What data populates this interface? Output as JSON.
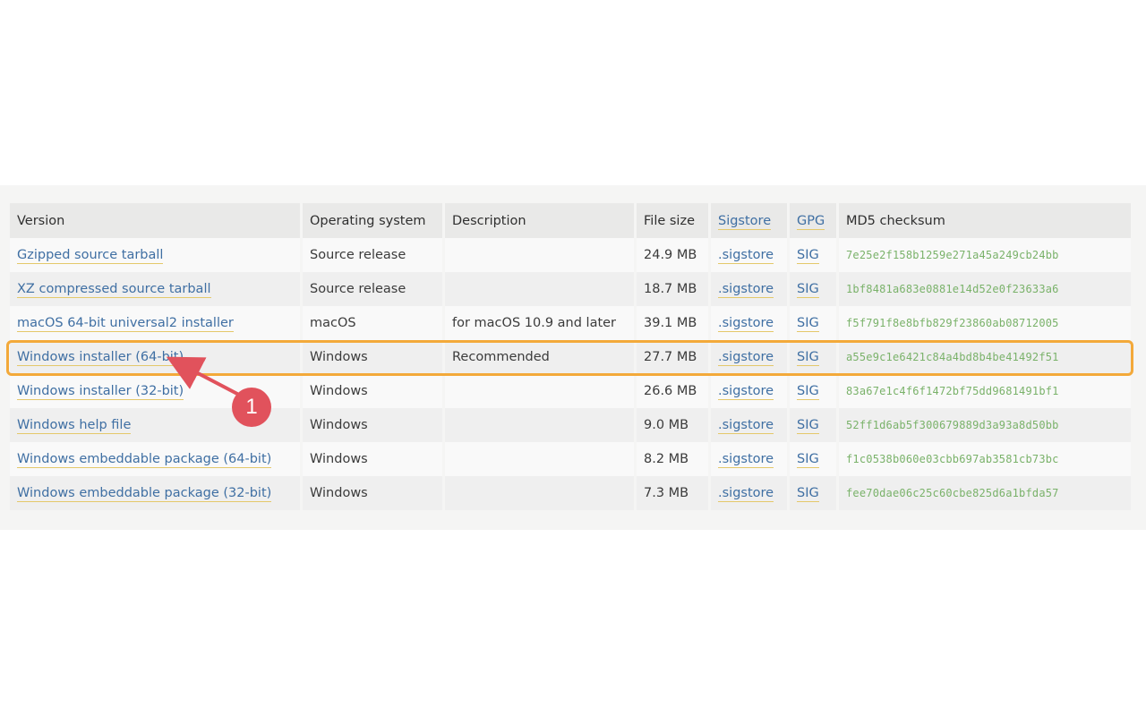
{
  "table": {
    "headers": {
      "version": "Version",
      "os": "Operating system",
      "description": "Description",
      "filesize": "File size",
      "sigstore": "Sigstore",
      "gpg": "GPG",
      "md5": "MD5 checksum"
    },
    "rows": [
      {
        "version": "Gzipped source tarball",
        "os": "Source release",
        "description": "",
        "filesize": "24.9 MB",
        "sigstore": ".sigstore",
        "gpg": "SIG",
        "md5": "7e25e2f158b1259e271a45a249cb24bb"
      },
      {
        "version": "XZ compressed source tarball",
        "os": "Source release",
        "description": "",
        "filesize": "18.7 MB",
        "sigstore": ".sigstore",
        "gpg": "SIG",
        "md5": "1bf8481a683e0881e14d52e0f23633a6"
      },
      {
        "version": "macOS 64-bit universal2 installer",
        "os": "macOS",
        "description": "for macOS 10.9 and later",
        "filesize": "39.1 MB",
        "sigstore": ".sigstore",
        "gpg": "SIG",
        "md5": "f5f791f8e8bfb829f23860ab08712005"
      },
      {
        "version": "Windows installer (64-bit)",
        "os": "Windows",
        "description": "Recommended",
        "filesize": "27.7 MB",
        "sigstore": ".sigstore",
        "gpg": "SIG",
        "md5": "a55e9c1e6421c84a4bd8b4be41492f51"
      },
      {
        "version": "Windows installer (32-bit)",
        "os": "Windows",
        "description": "",
        "filesize": "26.6 MB",
        "sigstore": ".sigstore",
        "gpg": "SIG",
        "md5": "83a67e1c4f6f1472bf75dd9681491bf1"
      },
      {
        "version": "Windows help file",
        "os": "Windows",
        "description": "",
        "filesize": "9.0 MB",
        "sigstore": ".sigstore",
        "gpg": "SIG",
        "md5": "52ff1d6ab5f300679889d3a93a8d50bb"
      },
      {
        "version": "Windows embeddable package (64-bit)",
        "os": "Windows",
        "description": "",
        "filesize": "8.2 MB",
        "sigstore": ".sigstore",
        "gpg": "SIG",
        "md5": "f1c0538b060e03cbb697ab3581cb73bc"
      },
      {
        "version": "Windows embeddable package (32-bit)",
        "os": "Windows",
        "description": "",
        "filesize": "7.3 MB",
        "sigstore": ".sigstore",
        "gpg": "SIG",
        "md5": "fee70dae06c25c60cbe825d6a1bfda57"
      }
    ]
  },
  "annotation": {
    "step_number": "1",
    "highlight_color": "#f3a93a",
    "marker_color": "#e1525c"
  },
  "colors": {
    "link": "#3f6fa3",
    "link_underline": "#e4c86a",
    "checksum": "#7ab26a"
  }
}
